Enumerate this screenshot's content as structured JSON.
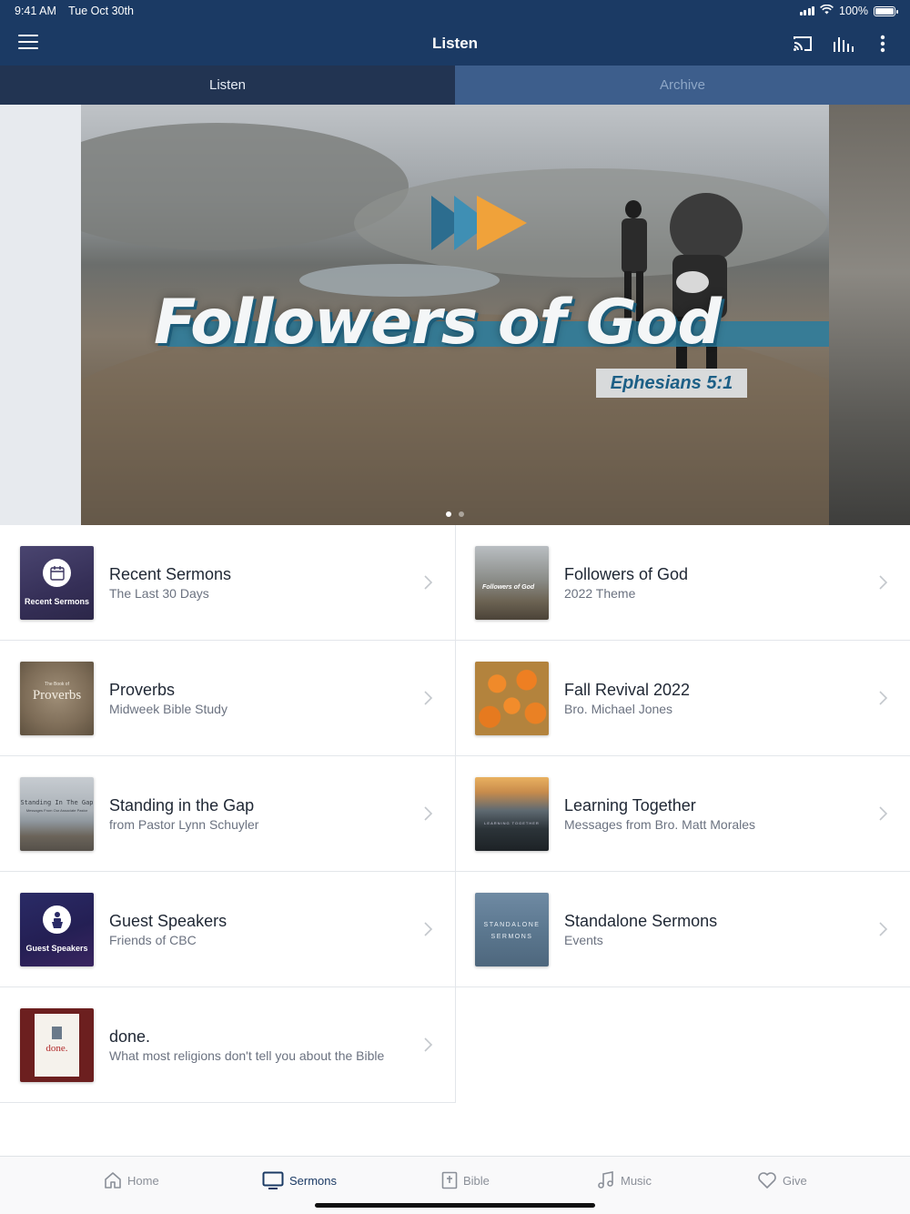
{
  "status_bar": {
    "time": "9:41 AM",
    "date": "Tue Oct 30th",
    "battery": "100%"
  },
  "app_bar": {
    "title": "Listen",
    "icons": [
      "menu-icon",
      "cast-icon",
      "audio-bars-icon",
      "more-vertical-icon"
    ]
  },
  "tabs": [
    {
      "label": "Listen",
      "active": true
    },
    {
      "label": "Archive",
      "active": false
    }
  ],
  "hero": {
    "title": "Followers of God",
    "reference": "Ephesians 5:1",
    "slides": 2,
    "active_slide": 1
  },
  "series": [
    {
      "title": "Recent Sermons",
      "subtitle": "The Last 30 Days",
      "thumb_label": "Recent Sermons",
      "thumb_icon": "calendar-icon"
    },
    {
      "title": "Followers of God",
      "subtitle": "2022 Theme",
      "thumb_label": "Followers of God",
      "thumb_icon": ""
    },
    {
      "title": "Proverbs",
      "subtitle": "Midweek Bible Study",
      "thumb_label": "Proverbs",
      "thumb_sub": "The Book of",
      "thumb_icon": ""
    },
    {
      "title": "Fall Revival 2022",
      "subtitle": "Bro. Michael Jones",
      "thumb_label": "",
      "thumb_icon": "pumpkins-image"
    },
    {
      "title": "Standing in the Gap",
      "subtitle": "from Pastor Lynn Schuyler",
      "thumb_label": "Standing In The Gap",
      "thumb_sub": "Messages From Our Associate Pastor",
      "thumb_icon": ""
    },
    {
      "title": "Learning Together",
      "subtitle": "Messages from Bro. Matt Morales",
      "thumb_label": "LEARNING TOGETHER",
      "thumb_icon": ""
    },
    {
      "title": "Guest Speakers",
      "subtitle": "Friends of CBC",
      "thumb_label": "Guest Speakers",
      "thumb_icon": "speaker-podium-icon"
    },
    {
      "title": "Standalone Sermons",
      "subtitle": "Events",
      "thumb_label": "STANDALONE",
      "thumb_label2": "SERMONS",
      "thumb_icon": ""
    },
    {
      "title": "done.",
      "subtitle": "What most religions don't tell you about the Bible",
      "thumb_label": "done.",
      "thumb_icon": ""
    }
  ],
  "bottom_nav": [
    {
      "label": "Home",
      "icon": "home-icon",
      "active": false
    },
    {
      "label": "Sermons",
      "icon": "tv-icon",
      "active": true
    },
    {
      "label": "Bible",
      "icon": "bible-icon",
      "active": false
    },
    {
      "label": "Music",
      "icon": "music-icon",
      "active": false
    },
    {
      "label": "Give",
      "icon": "heart-icon",
      "active": false
    }
  ],
  "colors": {
    "primary": "#1b3a64",
    "tab_active": "#223452",
    "tab_inactive": "#3d5e8c",
    "hero_accent": "#2f7c9b"
  }
}
